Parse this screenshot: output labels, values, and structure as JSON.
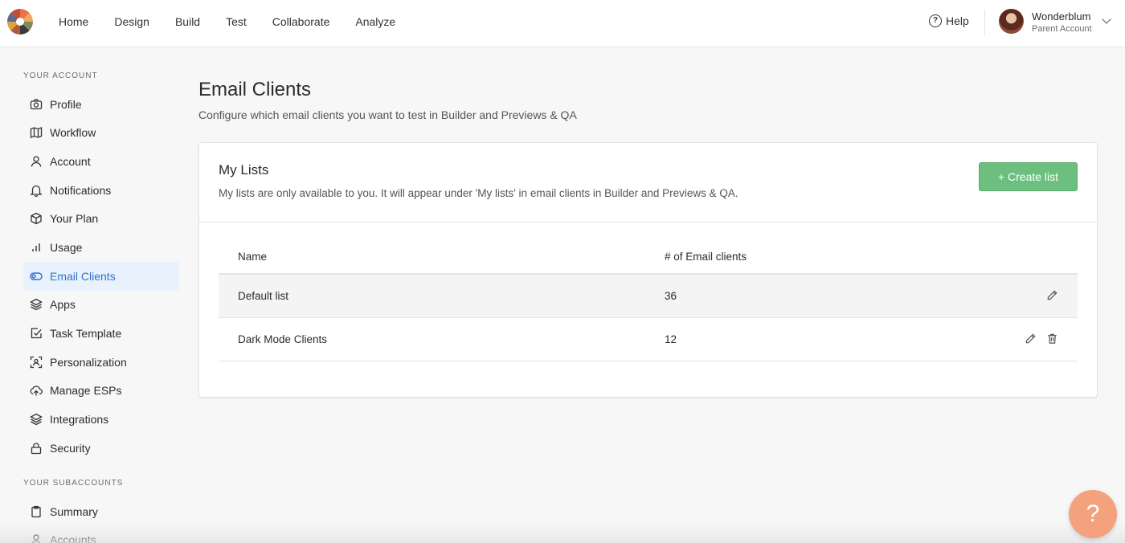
{
  "topbar": {
    "nav": [
      "Home",
      "Design",
      "Build",
      "Test",
      "Collaborate",
      "Analyze"
    ],
    "help_label": "Help",
    "user_name": "Wonderblum",
    "user_sub": "Parent Account"
  },
  "sidebar": {
    "section_account": "YOUR ACCOUNT",
    "items": [
      {
        "label": "Profile",
        "icon": "camera-icon"
      },
      {
        "label": "Workflow",
        "icon": "map-icon"
      },
      {
        "label": "Account",
        "icon": "user-icon"
      },
      {
        "label": "Notifications",
        "icon": "bell-icon"
      },
      {
        "label": "Your Plan",
        "icon": "box-icon"
      },
      {
        "label": "Usage",
        "icon": "bar-chart-icon"
      },
      {
        "label": "Email Clients",
        "icon": "toggle-icon",
        "active": true
      },
      {
        "label": "Apps",
        "icon": "layers-icon"
      },
      {
        "label": "Task Template",
        "icon": "check-square-icon"
      },
      {
        "label": "Personalization",
        "icon": "face-scan-icon"
      },
      {
        "label": "Manage ESPs",
        "icon": "upload-cloud-icon"
      },
      {
        "label": "Integrations",
        "icon": "layers-icon"
      },
      {
        "label": "Security",
        "icon": "lock-icon"
      }
    ],
    "section_subaccounts": "YOUR SUBACCOUNTS",
    "sub_items": [
      {
        "label": "Summary",
        "icon": "clipboard-icon"
      },
      {
        "label": "Accounts",
        "icon": "user-icon"
      }
    ]
  },
  "main": {
    "title": "Email Clients",
    "subtitle": "Configure which email clients you want to test in Builder and Previews & QA",
    "card": {
      "title": "My Lists",
      "subtitle": "My lists are only available to you. It will appear under 'My lists' in email clients in Builder and Previews & QA.",
      "create_label": "+ Create list",
      "columns": [
        "Name",
        "# of Email clients"
      ],
      "rows": [
        {
          "name": "Default list",
          "count": "36"
        },
        {
          "name": "Dark Mode Clients",
          "count": "12"
        }
      ]
    }
  },
  "fab_label": "?",
  "colors": {
    "accent": "#2f73c9",
    "active_bg": "#e8f1fc",
    "create_button": "#6cbf7f",
    "fab": "#f4a27d"
  }
}
